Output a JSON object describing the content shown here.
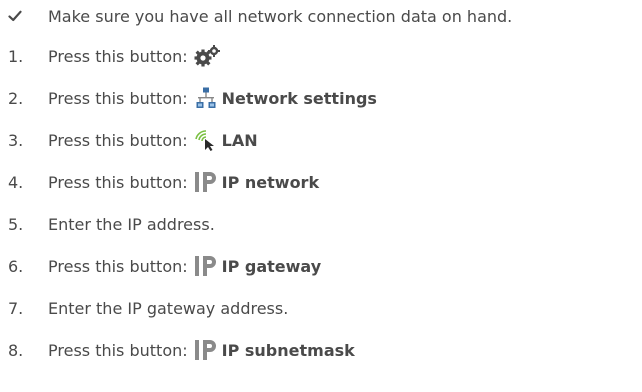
{
  "prerequisite": {
    "marker": "✓",
    "text": "Make sure you have all network connection data on hand."
  },
  "steps": [
    {
      "number": "1.",
      "text": "Press this button:",
      "icon": "gears-icon",
      "label": ""
    },
    {
      "number": "2.",
      "text": "Press this button:",
      "icon": "network-settings-icon",
      "label": "Network settings"
    },
    {
      "number": "3.",
      "text": "Press this button:",
      "icon": "lan-icon",
      "label": "LAN"
    },
    {
      "number": "4.",
      "text": "Press this button:",
      "icon": "ip-icon",
      "label": "IP network"
    },
    {
      "number": "5.",
      "text": "Enter the IP address.",
      "icon": "",
      "label": ""
    },
    {
      "number": "6.",
      "text": "Press this button:",
      "icon": "ip-icon",
      "label": "IP gateway"
    },
    {
      "number": "7.",
      "text": "Enter the IP gateway address.",
      "icon": "",
      "label": ""
    },
    {
      "number": "8.",
      "text": "Press this button:",
      "icon": "ip-icon",
      "label": "IP subnetmask"
    }
  ],
  "colors": {
    "text": "#4a4a4a",
    "ip_icon": "#8a8a8a",
    "lan_wave": "#7bc043",
    "network_icon": "#3a6ea5"
  }
}
